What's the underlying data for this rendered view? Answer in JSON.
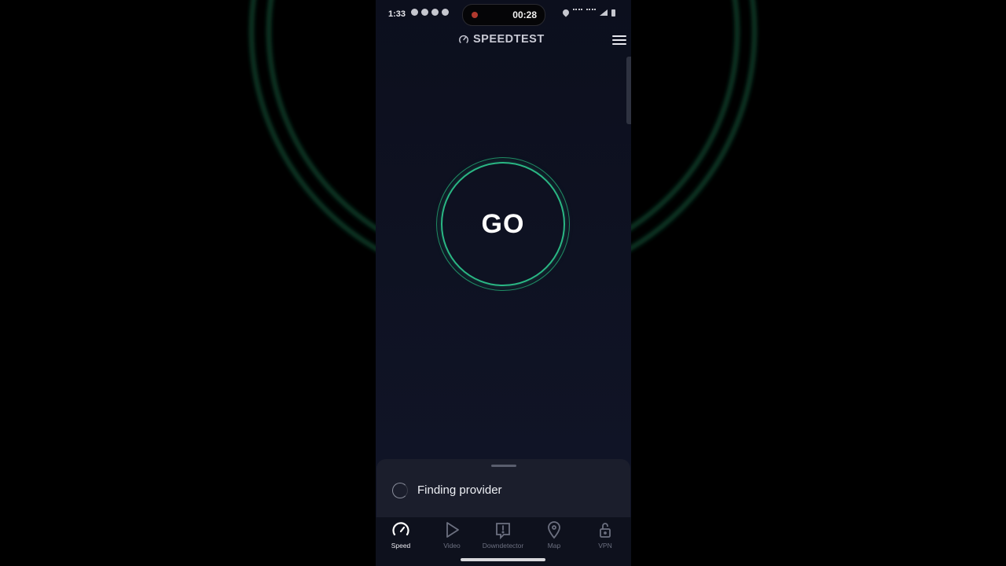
{
  "status_bar": {
    "time": "1:33",
    "recording_time": "00:28"
  },
  "header": {
    "brand": "SPEEDTEST",
    "brand_icon": "speedometer-icon",
    "menu_icon": "hamburger-menu-icon"
  },
  "go_button": {
    "label": "GO",
    "ring_color": "#2ab784"
  },
  "provider_sheet": {
    "status_text": "Finding provider"
  },
  "bottom_nav": {
    "items": [
      {
        "label": "Speed",
        "icon": "speedometer-icon",
        "active": true
      },
      {
        "label": "Video",
        "icon": "play-icon",
        "active": false
      },
      {
        "label": "Downdetector",
        "icon": "alert-icon",
        "active": false
      },
      {
        "label": "Map",
        "icon": "map-pin-icon",
        "active": false
      },
      {
        "label": "VPN",
        "icon": "unlock-icon",
        "active": false
      }
    ]
  },
  "colors": {
    "accent": "#2ab784",
    "background": "#0c0f1d"
  }
}
